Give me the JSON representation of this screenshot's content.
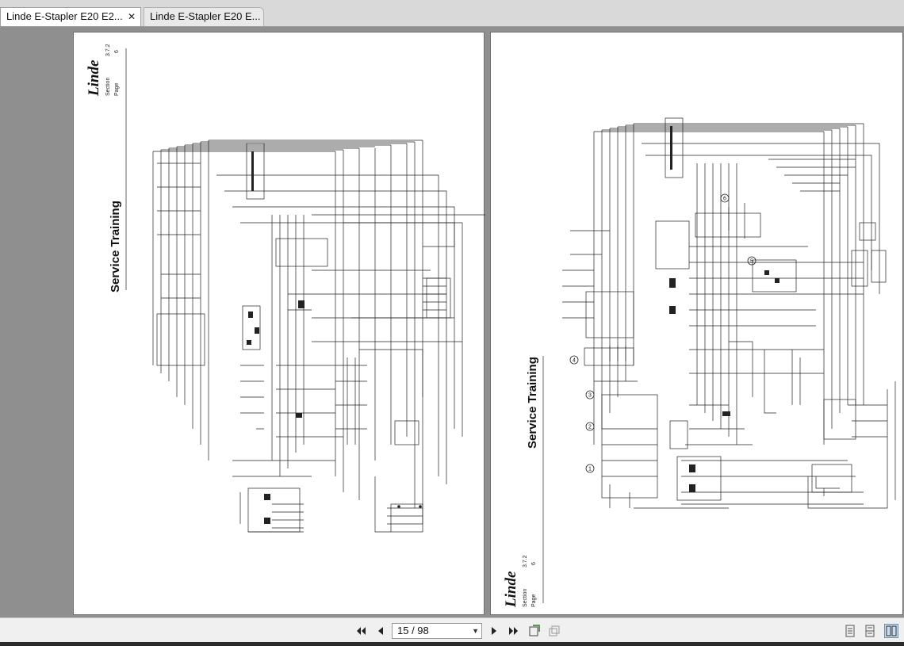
{
  "tabs": [
    {
      "label": "Linde E-Stapler E20 E2...",
      "active": true,
      "close_icon": "close-icon"
    },
    {
      "label": "Linde E-Stapler E20 E...",
      "active": false
    }
  ],
  "pages": [
    {
      "brand": "Linde",
      "section_label": "Section",
      "section_value": "3.7.2",
      "page_label": "Page",
      "page_value": "6",
      "title": "Service Training"
    },
    {
      "brand": "Linde",
      "section_label": "Section",
      "section_value": "3.7.2",
      "page_label": "Page",
      "page_value": "6",
      "title": "Service Training",
      "callouts": [
        "6",
        "5",
        "4",
        "3",
        "2",
        "1"
      ]
    }
  ],
  "toolbar": {
    "page_indicator": "15 / 98",
    "icons": [
      "first-page-icon",
      "previous-page-icon",
      "next-page-icon",
      "last-page-icon",
      "fit-width-icon",
      "fit-page-icon",
      "single-page-icon",
      "continuous-icon",
      "two-page-icon"
    ]
  }
}
